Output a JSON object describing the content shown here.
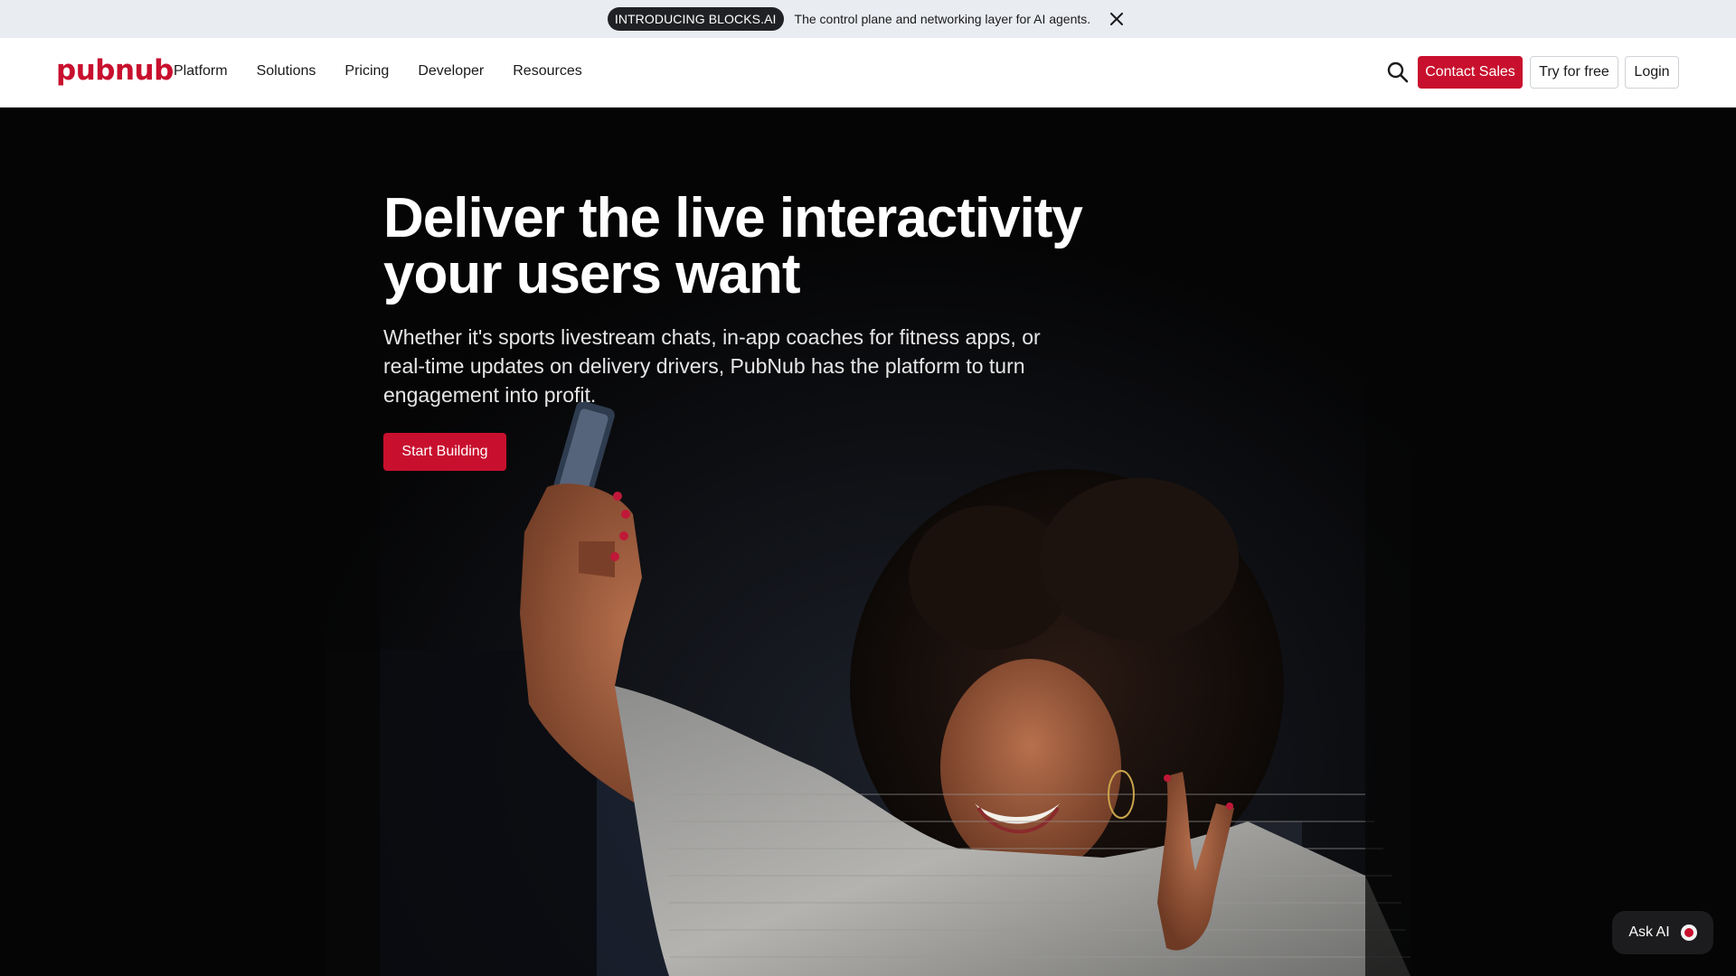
{
  "announcement": {
    "badge": "INTRODUCING BLOCKS.AI",
    "message": "The control plane and networking layer for AI agents."
  },
  "header": {
    "logo": "pubnub",
    "nav": [
      "Platform",
      "Solutions",
      "Pricing",
      "Developer",
      "Resources"
    ],
    "contact_sales": "Contact Sales",
    "try_free": "Try for free",
    "login": "Login"
  },
  "hero": {
    "title_line1": "Deliver the live interactivity",
    "title_line2": "your users want",
    "subtitle": "Whether it's sports livestream chats, in-app coaches for fitness apps, or real-time updates on delivery drivers, PubNub has the platform to turn engagement into profit.",
    "cta": "Start Building"
  },
  "ask_ai": {
    "label": "Ask AI"
  },
  "colors": {
    "brand": "#c8102e",
    "announcement_bg": "#e9ecf1",
    "hero_bg": "#050506"
  }
}
